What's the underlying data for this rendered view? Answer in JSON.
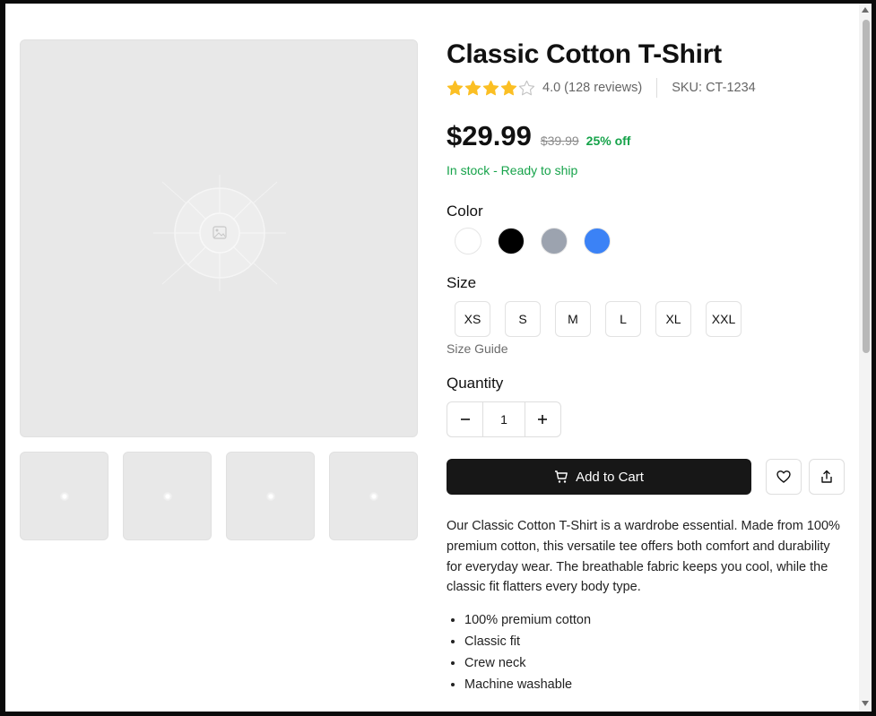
{
  "product": {
    "title": "Classic Cotton T-Shirt",
    "rating_text": "4.0 (128 reviews)",
    "rating_value": 4,
    "rating_max": 5,
    "sku_text": "SKU: CT-1234",
    "price": "$29.99",
    "old_price": "$39.99",
    "discount": "25% off",
    "stock": "In stock - Ready to ship"
  },
  "color": {
    "label": "Color",
    "options": [
      {
        "name": "white",
        "hex": "#ffffff"
      },
      {
        "name": "black",
        "hex": "#000000"
      },
      {
        "name": "gray",
        "hex": "#9ca3af"
      },
      {
        "name": "blue",
        "hex": "#3b82f6"
      }
    ]
  },
  "size": {
    "label": "Size",
    "options": [
      "XS",
      "S",
      "M",
      "L",
      "XL",
      "XXL"
    ],
    "guide_label": "Size Guide"
  },
  "quantity": {
    "label": "Quantity",
    "value": "1"
  },
  "actions": {
    "add_to_cart": "Add to Cart"
  },
  "description": "Our Classic Cotton T-Shirt is a wardrobe essential. Made from 100% premium cotton, this versatile tee offers both comfort and durability for everyday wear. The breathable fabric keeps you cool, while the classic fit flatters every body type.",
  "features": [
    "100% premium cotton",
    "Classic fit",
    "Crew neck",
    "Machine washable"
  ],
  "colors": {
    "accent_green": "#16a34a",
    "star": "#fbbf24",
    "button_dark": "#171717"
  }
}
